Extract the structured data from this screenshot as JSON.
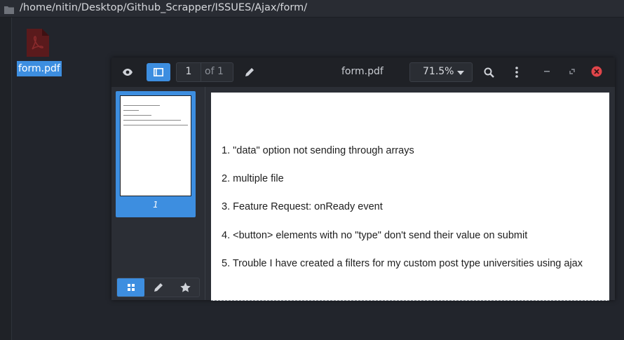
{
  "file_manager": {
    "path": "/home/nitin/Desktop/Github_Scrapper/ISSUES/Ajax/form/",
    "file_label": "form.pdf",
    "folder_icon": "folder-icon",
    "file_icon": "pdf-file-icon"
  },
  "viewer": {
    "toolbar": {
      "page_current": "1",
      "page_total": "of 1",
      "filename": "form.pdf",
      "zoom": "71.5%",
      "icons": [
        "eye-icon",
        "sidebar-toggle-icon",
        "pen-icon",
        "search-icon",
        "kebab-menu-icon",
        "minimize-icon",
        "restore-icon",
        "close-icon"
      ]
    },
    "sidebar": {
      "thumbnail_page_label": "1",
      "tabs": [
        "thumbnails-icon",
        "annotations-icon",
        "bookmarks-icon"
      ]
    },
    "document": {
      "lines": [
        "1. \"data\" option not sending through arrays",
        "2. multiple file",
        "3. Feature Request: onReady event",
        "4. <button> elements with no \"type\" don't send their value on submit",
        "5. Trouble I have created a filters for my custom post type universities using ajax"
      ]
    }
  },
  "colors": {
    "accent": "#3d8ee0",
    "close": "#e0454a",
    "background": "#22252c"
  }
}
